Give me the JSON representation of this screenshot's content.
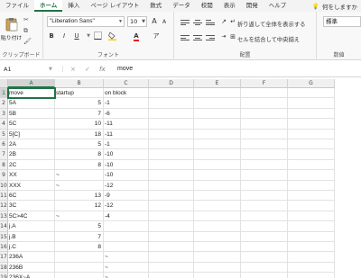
{
  "tabs": [
    {
      "label": "ファイル",
      "active": false
    },
    {
      "label": "ホーム",
      "active": true
    },
    {
      "label": "挿入",
      "active": false
    },
    {
      "label": "ページ レイアウト",
      "active": false
    },
    {
      "label": "数式",
      "active": false
    },
    {
      "label": "データ",
      "active": false
    },
    {
      "label": "校閲",
      "active": false
    },
    {
      "label": "表示",
      "active": false
    },
    {
      "label": "開発",
      "active": false
    },
    {
      "label": "ヘルプ",
      "active": false
    }
  ],
  "tell_me": "何をしますか",
  "ribbon": {
    "paste_label": "貼り付け",
    "clipboard_label": "クリップボード",
    "font_label": "フォント",
    "font_name": "\"Liberation Sans\"",
    "font_size": "10",
    "grow_font": "A",
    "shrink_font": "A",
    "bold": "B",
    "italic": "I",
    "underline": "U",
    "font_color_glyph": "A",
    "phonetic": "ア",
    "alignment_label": "配置",
    "wrap_text": "折り返して全体を表示する",
    "merge_center": "セルを結合して中央揃え",
    "number_format": "標準",
    "number_label": "数値",
    "accent_color": "#217346",
    "font_color": "#e02020",
    "fill_color": "#f5d000"
  },
  "formula_bar": {
    "name_box": "A1",
    "formula": "move",
    "cancel": "×",
    "enter": "✓",
    "fx": "fx"
  },
  "columns": [
    "A",
    "B",
    "C",
    "D",
    "E",
    "F",
    "G"
  ],
  "rows": [
    {
      "n": "1",
      "a": "move",
      "b": "startup",
      "c": "on block"
    },
    {
      "n": "2",
      "a": "5A",
      "b": "5",
      "c": "-1"
    },
    {
      "n": "3",
      "a": "5B",
      "b": "7",
      "c": "-6"
    },
    {
      "n": "4",
      "a": "5C",
      "b": "10",
      "c": "-11"
    },
    {
      "n": "5",
      "a": "5[C]",
      "b": "18",
      "c": "-11"
    },
    {
      "n": "6",
      "a": "2A",
      "b": "5",
      "c": "-1"
    },
    {
      "n": "7",
      "a": "2B",
      "b": "8",
      "c": "-10"
    },
    {
      "n": "8",
      "a": "2C",
      "b": "8",
      "c": "-10"
    },
    {
      "n": "9",
      "a": "XX",
      "b": "~",
      "c": "-10"
    },
    {
      "n": "10",
      "a": "XXX",
      "b": "~",
      "c": "-12"
    },
    {
      "n": "11",
      "a": "6C",
      "b": "13",
      "c": "-9"
    },
    {
      "n": "12",
      "a": "3C",
      "b": "12",
      "c": "-12"
    },
    {
      "n": "13",
      "a": "5C>4C",
      "b": "~",
      "c": "-4"
    },
    {
      "n": "14",
      "a": "j.A",
      "b": "5",
      "c": ""
    },
    {
      "n": "15",
      "a": "j.B",
      "b": "7",
      "c": ""
    },
    {
      "n": "16",
      "a": "j.C",
      "b": "8",
      "c": ""
    },
    {
      "n": "17",
      "a": "236A",
      "b": "",
      "c": "~"
    },
    {
      "n": "18",
      "a": "236B",
      "b": "",
      "c": "~"
    },
    {
      "n": "19",
      "a": "236X~A",
      "b": "",
      "c": "~"
    }
  ]
}
